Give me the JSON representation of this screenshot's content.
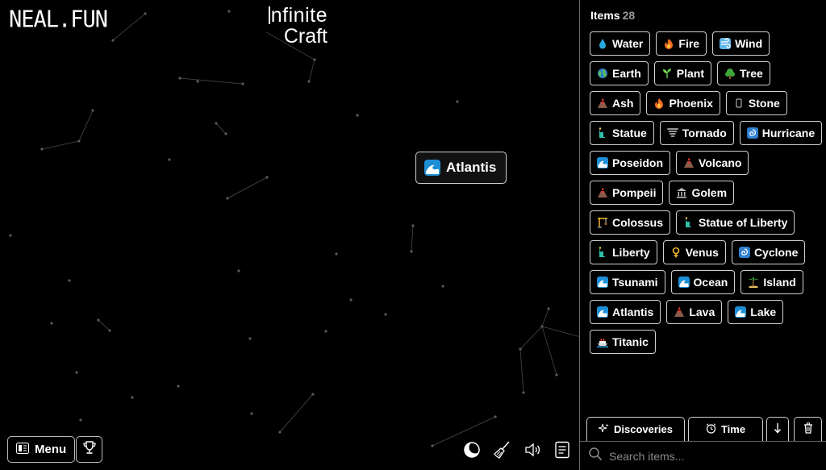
{
  "app": {
    "logo": "NEAL.FUN",
    "title_line1": "nfinite",
    "title_line2": "Craft"
  },
  "canvas": {
    "item": {
      "label": "Atlantis",
      "icon": "wave-icon"
    }
  },
  "controls": {
    "menu_label": "Menu",
    "bottom_icons": [
      "moon-icon",
      "broom-icon",
      "speaker-icon",
      "notes-icon"
    ]
  },
  "sidebar": {
    "header_label": "Items",
    "count": "28",
    "rows": [
      [
        {
          "label": "Water",
          "icon": "droplet-icon"
        },
        {
          "label": "Fire",
          "icon": "fire-icon"
        },
        {
          "label": "Wind",
          "icon": "wind-icon"
        }
      ],
      [
        {
          "label": "Earth",
          "icon": "globe-icon"
        },
        {
          "label": "Plant",
          "icon": "seedling-icon"
        },
        {
          "label": "Tree",
          "icon": "tree-icon"
        }
      ],
      [
        {
          "label": "Ash",
          "icon": "volcano-icon"
        },
        {
          "label": "Phoenix",
          "icon": "fire-icon"
        },
        {
          "label": "Stone",
          "icon": "stone-icon"
        }
      ],
      [
        {
          "label": "Statue",
          "icon": "statue-icon"
        },
        {
          "label": "Tornado",
          "icon": "tornado-icon"
        },
        {
          "label": "Hurricane",
          "icon": "cyclone-icon"
        }
      ],
      [
        {
          "label": "Poseidon",
          "icon": "wave-icon"
        },
        {
          "label": "Volcano",
          "icon": "volcano-icon"
        }
      ],
      [
        {
          "label": "Pompeii",
          "icon": "volcano-icon"
        },
        {
          "label": "Golem",
          "icon": "temple-icon"
        }
      ],
      [
        {
          "label": "Colossus",
          "icon": "crane-icon"
        },
        {
          "label": "Statue of Liberty",
          "icon": "statue-icon"
        }
      ],
      [
        {
          "label": "Liberty",
          "icon": "statue-icon"
        },
        {
          "label": "Venus",
          "icon": "venus-icon"
        },
        {
          "label": "Cyclone",
          "icon": "cyclone-icon"
        }
      ],
      [
        {
          "label": "Tsunami",
          "icon": "wave-icon"
        },
        {
          "label": "Ocean",
          "icon": "wave-icon"
        },
        {
          "label": "Island",
          "icon": "palm-icon"
        }
      ],
      [
        {
          "label": "Atlantis",
          "icon": "wave-icon"
        },
        {
          "label": "Lava",
          "icon": "volcano-icon"
        },
        {
          "label": "Lake",
          "icon": "wave-icon"
        }
      ],
      [
        {
          "label": "Titanic",
          "icon": "ship-icon"
        }
      ]
    ]
  },
  "tabs": {
    "discoveries_label": "Discoveries",
    "time_label": "Time",
    "sort_icon": "arrow-down-icon",
    "delete_icon": "trash-icon"
  },
  "search": {
    "placeholder": "Search items..."
  },
  "colors": {
    "background": "#000000",
    "border": "#cfcfcf",
    "muted": "#9a9a9a",
    "water": "#29a8e0",
    "fire": "#f36d21",
    "lava": "#e23b2e"
  }
}
